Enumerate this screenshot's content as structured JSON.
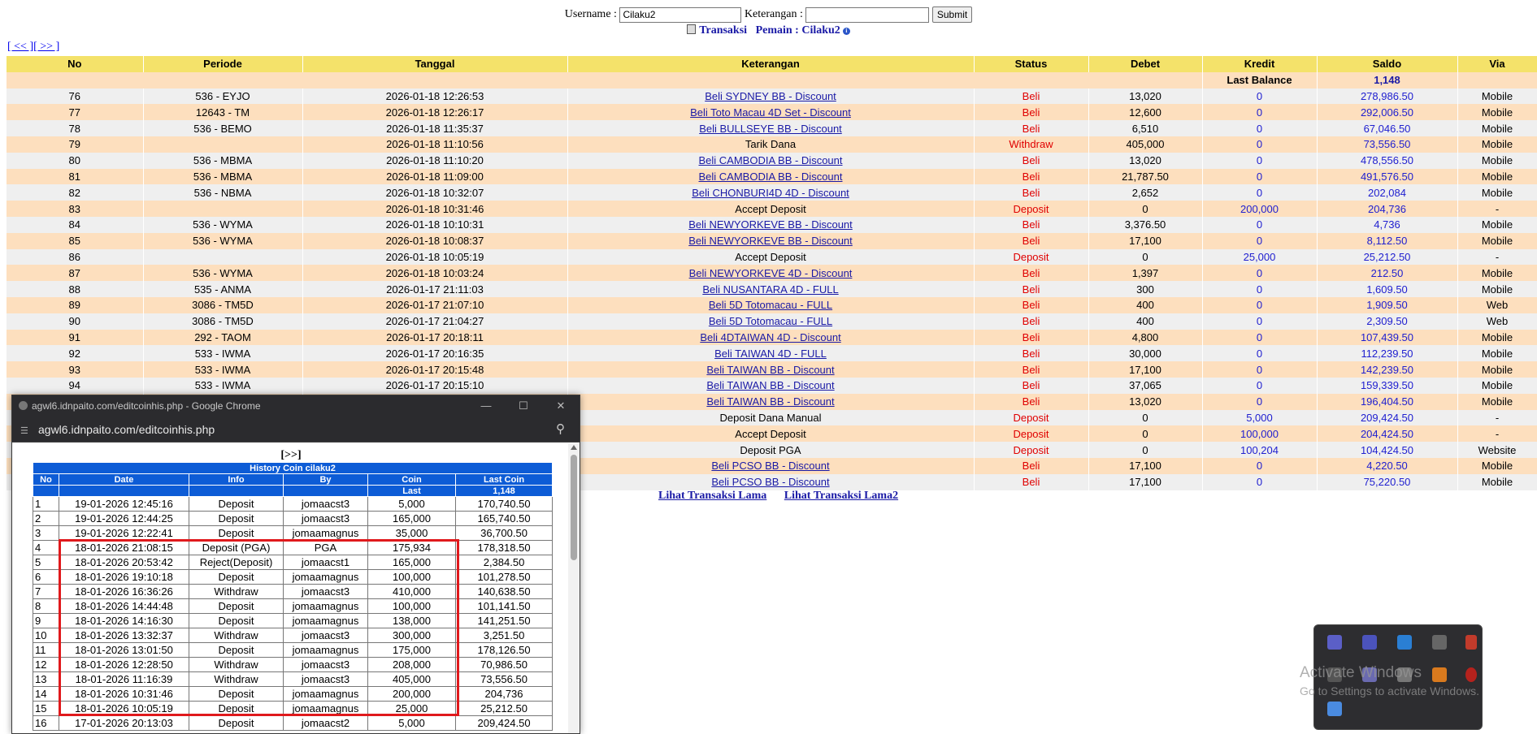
{
  "form": {
    "username_label": "Username :",
    "username_value": "Cilaku2",
    "keterangan_label": "Keterangan :",
    "keterangan_value": "",
    "submit_label": "Submit"
  },
  "subtitle": {
    "transaksi": "Transaksi",
    "pemain": "Pemain : Cilaku2"
  },
  "pager": {
    "prev": "[ << ]",
    "next": "[ >> ]"
  },
  "main_table": {
    "headers": [
      "No",
      "Periode",
      "Tanggal",
      "Keterangan",
      "Status",
      "Debet",
      "Kredit",
      "Saldo",
      "Via"
    ],
    "last_balance_label": "Last Balance",
    "last_balance_value": "1,148",
    "rows": [
      {
        "no": "76",
        "periode": "536 - EYJO",
        "tanggal": "2026-01-18 12:26:53",
        "ket": "Beli SYDNEY BB - Discount",
        "link": true,
        "status": "Beli",
        "debet": "13,020",
        "kredit": "0",
        "saldo": "278,986.50",
        "via": "Mobile"
      },
      {
        "no": "77",
        "periode": "12643 - TM",
        "tanggal": "2026-01-18 12:26:17",
        "ket": "Beli Toto Macau 4D Set - Discount",
        "link": true,
        "status": "Beli",
        "debet": "12,600",
        "kredit": "0",
        "saldo": "292,006.50",
        "via": "Mobile"
      },
      {
        "no": "78",
        "periode": "536 - BEMO",
        "tanggal": "2026-01-18 11:35:37",
        "ket": "Beli BULLSEYE BB - Discount",
        "link": true,
        "status": "Beli",
        "debet": "6,510",
        "kredit": "0",
        "saldo": "67,046.50",
        "via": "Mobile"
      },
      {
        "no": "79",
        "periode": "",
        "tanggal": "2026-01-18 11:10:56",
        "ket": "Tarik Dana",
        "link": false,
        "status": "Withdraw",
        "debet": "405,000",
        "kredit": "0",
        "saldo": "73,556.50",
        "via": "Mobile"
      },
      {
        "no": "80",
        "periode": "536 - MBMA",
        "tanggal": "2026-01-18 11:10:20",
        "ket": "Beli CAMBODIA BB - Discount",
        "link": true,
        "status": "Beli",
        "debet": "13,020",
        "kredit": "0",
        "saldo": "478,556.50",
        "via": "Mobile"
      },
      {
        "no": "81",
        "periode": "536 - MBMA",
        "tanggal": "2026-01-18 11:09:00",
        "ket": "Beli CAMBODIA BB - Discount",
        "link": true,
        "status": "Beli",
        "debet": "21,787.50",
        "kredit": "0",
        "saldo": "491,576.50",
        "via": "Mobile"
      },
      {
        "no": "82",
        "periode": "536 - NBMA",
        "tanggal": "2026-01-18 10:32:07",
        "ket": "Beli CHONBURI4D 4D - Discount",
        "link": true,
        "status": "Beli",
        "debet": "2,652",
        "kredit": "0",
        "saldo": "202,084",
        "via": "Mobile"
      },
      {
        "no": "83",
        "periode": "",
        "tanggal": "2026-01-18 10:31:46",
        "ket": "Accept Deposit",
        "link": false,
        "status": "Deposit",
        "debet": "0",
        "kredit": "200,000",
        "saldo": "204,736",
        "via": "-"
      },
      {
        "no": "84",
        "periode": "536 - WYMA",
        "tanggal": "2026-01-18 10:10:31",
        "ket": "Beli NEWYORKEVE BB - Discount",
        "link": true,
        "status": "Beli",
        "debet": "3,376.50",
        "kredit": "0",
        "saldo": "4,736",
        "via": "Mobile"
      },
      {
        "no": "85",
        "periode": "536 - WYMA",
        "tanggal": "2026-01-18 10:08:37",
        "ket": "Beli NEWYORKEVE BB - Discount",
        "link": true,
        "status": "Beli",
        "debet": "17,100",
        "kredit": "0",
        "saldo": "8,112.50",
        "via": "Mobile"
      },
      {
        "no": "86",
        "periode": "",
        "tanggal": "2026-01-18 10:05:19",
        "ket": "Accept Deposit",
        "link": false,
        "status": "Deposit",
        "debet": "0",
        "kredit": "25,000",
        "saldo": "25,212.50",
        "via": "-"
      },
      {
        "no": "87",
        "periode": "536 - WYMA",
        "tanggal": "2026-01-18 10:03:24",
        "ket": "Beli NEWYORKEVE 4D - Discount",
        "link": true,
        "status": "Beli",
        "debet": "1,397",
        "kredit": "0",
        "saldo": "212.50",
        "via": "Mobile"
      },
      {
        "no": "88",
        "periode": "535 - ANMA",
        "tanggal": "2026-01-17 21:11:03",
        "ket": "Beli NUSANTARA 4D - FULL",
        "link": true,
        "status": "Beli",
        "debet": "300",
        "kredit": "0",
        "saldo": "1,609.50",
        "via": "Mobile"
      },
      {
        "no": "89",
        "periode": "3086 - TM5D",
        "tanggal": "2026-01-17 21:07:10",
        "ket": "Beli 5D Totomacau - FULL",
        "link": true,
        "status": "Beli",
        "debet": "400",
        "kredit": "0",
        "saldo": "1,909.50",
        "via": "Web"
      },
      {
        "no": "90",
        "periode": "3086 - TM5D",
        "tanggal": "2026-01-17 21:04:27",
        "ket": "Beli 5D Totomacau - FULL",
        "link": true,
        "status": "Beli",
        "debet": "400",
        "kredit": "0",
        "saldo": "2,309.50",
        "via": "Web"
      },
      {
        "no": "91",
        "periode": "292 - TAOM",
        "tanggal": "2026-01-17 20:18:11",
        "ket": "Beli 4DTAIWAN 4D - Discount",
        "link": true,
        "status": "Beli",
        "debet": "4,800",
        "kredit": "0",
        "saldo": "107,439.50",
        "via": "Mobile"
      },
      {
        "no": "92",
        "periode": "533 - IWMA",
        "tanggal": "2026-01-17 20:16:35",
        "ket": "Beli TAIWAN 4D - FULL",
        "link": true,
        "status": "Beli",
        "debet": "30,000",
        "kredit": "0",
        "saldo": "112,239.50",
        "via": "Mobile"
      },
      {
        "no": "93",
        "periode": "533 - IWMA",
        "tanggal": "2026-01-17 20:15:48",
        "ket": "Beli TAIWAN BB - Discount",
        "link": true,
        "status": "Beli",
        "debet": "17,100",
        "kredit": "0",
        "saldo": "142,239.50",
        "via": "Mobile"
      },
      {
        "no": "94",
        "periode": "533 - IWMA",
        "tanggal": "2026-01-17 20:15:10",
        "ket": "Beli TAIWAN BB - Discount",
        "link": true,
        "status": "Beli",
        "debet": "37,065",
        "kredit": "0",
        "saldo": "159,339.50",
        "via": "Mobile"
      },
      {
        "no": "",
        "periode": "",
        "tanggal": "",
        "ket": "Beli TAIWAN BB - Discount",
        "link": true,
        "status": "Beli",
        "debet": "13,020",
        "kredit": "0",
        "saldo": "196,404.50",
        "via": "Mobile"
      },
      {
        "no": "",
        "periode": "",
        "tanggal": "",
        "ket": "Deposit Dana Manual",
        "link": false,
        "status": "Deposit",
        "debet": "0",
        "kredit": "5,000",
        "saldo": "209,424.50",
        "via": "-"
      },
      {
        "no": "",
        "periode": "",
        "tanggal": "",
        "ket": "Accept Deposit",
        "link": false,
        "status": "Deposit",
        "debet": "0",
        "kredit": "100,000",
        "saldo": "204,424.50",
        "via": "-"
      },
      {
        "no": "",
        "periode": "",
        "tanggal": "",
        "ket": "Deposit PGA",
        "link": false,
        "status": "Deposit",
        "debet": "0",
        "kredit": "100,204",
        "saldo": "104,424.50",
        "via": "Website"
      },
      {
        "no": "",
        "periode": "",
        "tanggal": "",
        "ket": "Beli PCSO BB - Discount",
        "link": true,
        "status": "Beli",
        "debet": "17,100",
        "kredit": "0",
        "saldo": "4,220.50",
        "via": "Mobile"
      },
      {
        "no": "",
        "periode": "",
        "tanggal": "",
        "ket": "Beli PCSO BB - Discount",
        "link": true,
        "status": "Beli",
        "debet": "17,100",
        "kredit": "0",
        "saldo": "75,220.50",
        "via": "Mobile"
      }
    ]
  },
  "old_links": {
    "lama": "Lihat Transaksi Lama",
    "lama2": "Lihat Transaksi Lama2"
  },
  "popup": {
    "window_title": "agwl6.idnpaito.com/editcoinhis.php - Google Chrome",
    "address": "agwl6.idnpaito.com/editcoinhis.php",
    "nav": "[>>]",
    "table_title": "History Coin cilaku2",
    "headers": [
      "No",
      "Date",
      "Info",
      "By",
      "Coin",
      "Last Coin"
    ],
    "last_label": "Last",
    "last_value": "1,148",
    "rows": [
      {
        "no": "1",
        "date": "19-01-2026 12:45:16",
        "info": "Deposit",
        "by": "jomaacst3",
        "coin": "5,000",
        "last": "170,740.50"
      },
      {
        "no": "2",
        "date": "19-01-2026 12:44:25",
        "info": "Deposit",
        "by": "jomaacst3",
        "coin": "165,000",
        "last": "165,740.50"
      },
      {
        "no": "3",
        "date": "19-01-2026 12:22:41",
        "info": "Deposit",
        "by": "jomaamagnus",
        "coin": "35,000",
        "last": "36,700.50"
      },
      {
        "no": "4",
        "date": "18-01-2026 21:08:15",
        "info": "Deposit (PGA)",
        "by": "PGA",
        "coin": "175,934",
        "last": "178,318.50"
      },
      {
        "no": "5",
        "date": "18-01-2026 20:53:42",
        "info": "Reject(Deposit)",
        "by": "jomaacst1",
        "coin": "165,000",
        "last": "2,384.50"
      },
      {
        "no": "6",
        "date": "18-01-2026 19:10:18",
        "info": "Deposit",
        "by": "jomaamagnus",
        "coin": "100,000",
        "last": "101,278.50"
      },
      {
        "no": "7",
        "date": "18-01-2026 16:36:26",
        "info": "Withdraw",
        "by": "jomaacst3",
        "coin": "410,000",
        "last": "140,638.50"
      },
      {
        "no": "8",
        "date": "18-01-2026 14:44:48",
        "info": "Deposit",
        "by": "jomaamagnus",
        "coin": "100,000",
        "last": "101,141.50"
      },
      {
        "no": "9",
        "date": "18-01-2026 14:16:30",
        "info": "Deposit",
        "by": "jomaamagnus",
        "coin": "138,000",
        "last": "141,251.50"
      },
      {
        "no": "10",
        "date": "18-01-2026 13:32:37",
        "info": "Withdraw",
        "by": "jomaacst3",
        "coin": "300,000",
        "last": "3,251.50"
      },
      {
        "no": "11",
        "date": "18-01-2026 13:01:50",
        "info": "Deposit",
        "by": "jomaamagnus",
        "coin": "175,000",
        "last": "178,126.50"
      },
      {
        "no": "12",
        "date": "18-01-2026 12:28:50",
        "info": "Withdraw",
        "by": "jomaacst3",
        "coin": "208,000",
        "last": "70,986.50"
      },
      {
        "no": "13",
        "date": "18-01-2026 11:16:39",
        "info": "Withdraw",
        "by": "jomaacst3",
        "coin": "405,000",
        "last": "73,556.50"
      },
      {
        "no": "14",
        "date": "18-01-2026 10:31:46",
        "info": "Deposit",
        "by": "jomaamagnus",
        "coin": "200,000",
        "last": "204,736"
      },
      {
        "no": "15",
        "date": "18-01-2026 10:05:19",
        "info": "Deposit",
        "by": "jomaamagnus",
        "coin": "25,000",
        "last": "25,212.50"
      },
      {
        "no": "16",
        "date": "17-01-2026 20:13:03",
        "info": "Deposit",
        "by": "jomaacst2",
        "coin": "5,000",
        "last": "209,424.50"
      }
    ]
  },
  "watermark": {
    "line1": "Activate Windows",
    "line2": "Go to Settings to activate Windows."
  },
  "colors": {
    "header_yellow": "#f4e26a",
    "row_peach": "#fddfbe",
    "row_gray": "#efefef",
    "status_red": "#e00000",
    "link_blue": "#1a1aa6",
    "coin_header_blue": "#0d5cd6",
    "highlight_red": "#e0191c"
  }
}
